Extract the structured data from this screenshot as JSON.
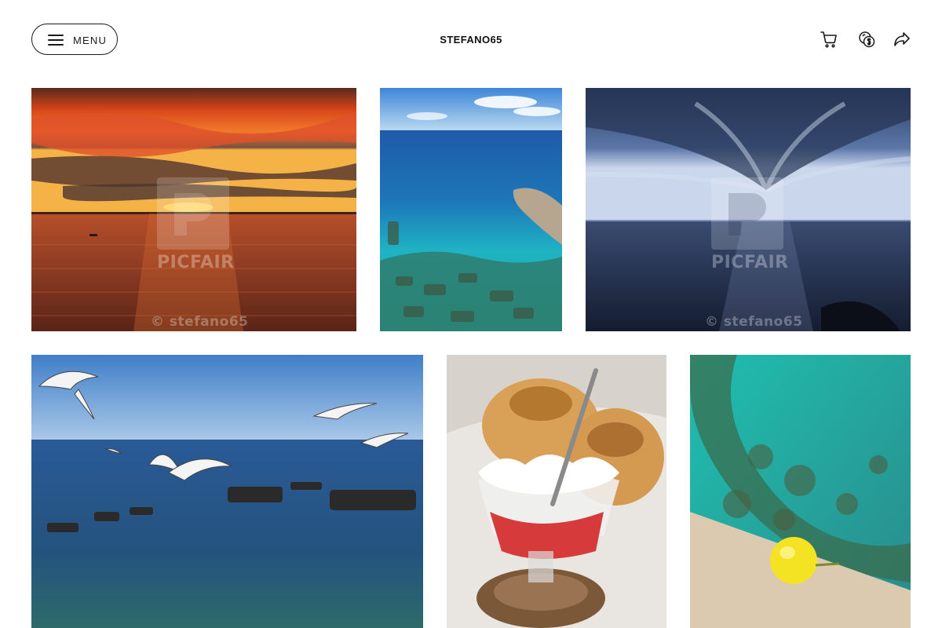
{
  "header": {
    "menu_label": "MENU",
    "brand": "STEFANO65",
    "icons": [
      "cart-icon",
      "currency-icon",
      "share-icon"
    ]
  },
  "gallery": {
    "watermark_brand": "PICFAIR",
    "watermark_credit": "© stefano65",
    "row1": [
      {
        "subject": "sunset over sea"
      },
      {
        "subject": "turquoise sea and rocks"
      },
      {
        "subject": "stormy sky over sea"
      }
    ],
    "row2": [
      {
        "subject": "seagulls over sea"
      },
      {
        "subject": "granita with brioche"
      },
      {
        "subject": "lemon on ledge above sea"
      }
    ]
  },
  "colors": {
    "text": "#111111",
    "border": "#1a1a1a",
    "background": "#ffffff"
  }
}
